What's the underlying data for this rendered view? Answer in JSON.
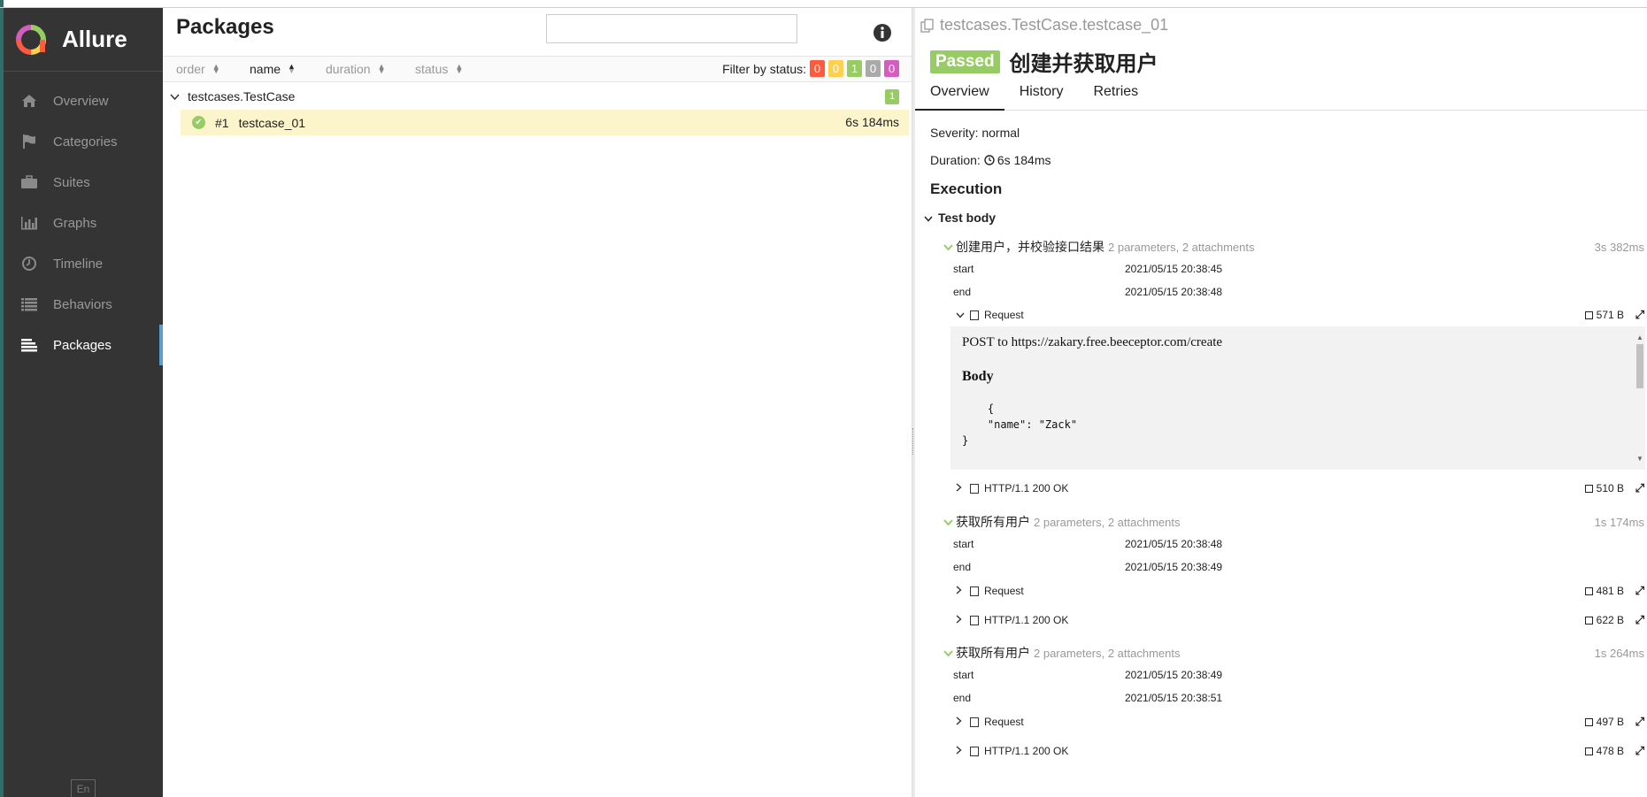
{
  "sidebar": {
    "brand": "Allure",
    "items": [
      {
        "label": "Overview",
        "icon": "home-icon"
      },
      {
        "label": "Categories",
        "icon": "flag-icon"
      },
      {
        "label": "Suites",
        "icon": "briefcase-icon"
      },
      {
        "label": "Graphs",
        "icon": "bar-chart-icon"
      },
      {
        "label": "Timeline",
        "icon": "clock-icon"
      },
      {
        "label": "Behaviors",
        "icon": "list-icon"
      },
      {
        "label": "Packages",
        "icon": "align-left-icon"
      }
    ],
    "active": "Packages",
    "lang": "En"
  },
  "packages": {
    "title": "Packages",
    "search_value": "",
    "sort": [
      {
        "label": "order"
      },
      {
        "label": "name"
      },
      {
        "label": "duration"
      },
      {
        "label": "status"
      }
    ],
    "filter_label": "Filter by status:",
    "filter_badges": [
      {
        "value": "0",
        "color": "#fd5a3e"
      },
      {
        "value": "0",
        "color": "#ffd050"
      },
      {
        "value": "1",
        "color": "#97cc64"
      },
      {
        "value": "0",
        "color": "#aaaaaa"
      },
      {
        "value": "0",
        "color": "#d35ebe"
      }
    ],
    "group": {
      "name": "testcases.TestCase",
      "count": "1"
    },
    "leaf": {
      "number": "#1",
      "name": "testcase_01",
      "duration": "6s 184ms"
    }
  },
  "detail": {
    "breadcrumb": "testcases.TestCase.testcase_01",
    "status": "Passed",
    "name": "创建并获取用户",
    "tabs": [
      "Overview",
      "History",
      "Retries"
    ],
    "severity": "Severity: normal",
    "duration_label": "Duration:",
    "duration": "6s 184ms",
    "execution": "Execution",
    "test_body": "Test body",
    "steps": [
      {
        "title": "创建用户，并校验接口结果",
        "info": "2 parameters, 2 attachments",
        "duration": "3s 382ms",
        "start_label": "start",
        "start": "2021/05/15 20:38:45",
        "end_label": "end",
        "end": "2021/05/15 20:38:48",
        "attachments": [
          {
            "name": "Request",
            "size": "571 B"
          },
          {
            "name": "HTTP/1.1 200 OK",
            "size": "510 B"
          }
        ]
      },
      {
        "title": "获取所有用户",
        "info": "2 parameters, 2 attachments",
        "duration": "1s 174ms",
        "start_label": "start",
        "start": "2021/05/15 20:38:48",
        "end_label": "end",
        "end": "2021/05/15 20:38:49",
        "attachments": [
          {
            "name": "Request",
            "size": "481 B"
          },
          {
            "name": "HTTP/1.1 200 OK",
            "size": "622 B"
          }
        ]
      },
      {
        "title": "获取所有用户",
        "info": "2 parameters, 2 attachments",
        "duration": "1s 264ms",
        "start_label": "start",
        "start": "2021/05/15 20:38:49",
        "end_label": "end",
        "end": "2021/05/15 20:38:51",
        "attachments": [
          {
            "name": "Request",
            "size": "497 B"
          },
          {
            "name": "HTTP/1.1 200 OK",
            "size": "478 B"
          }
        ]
      }
    ],
    "request_preview": {
      "line": "POST to https://zakary.free.beeceptor.com/create",
      "body_label": "Body",
      "body": "    {\n    \"name\": \"Zack\"\n}"
    }
  }
}
